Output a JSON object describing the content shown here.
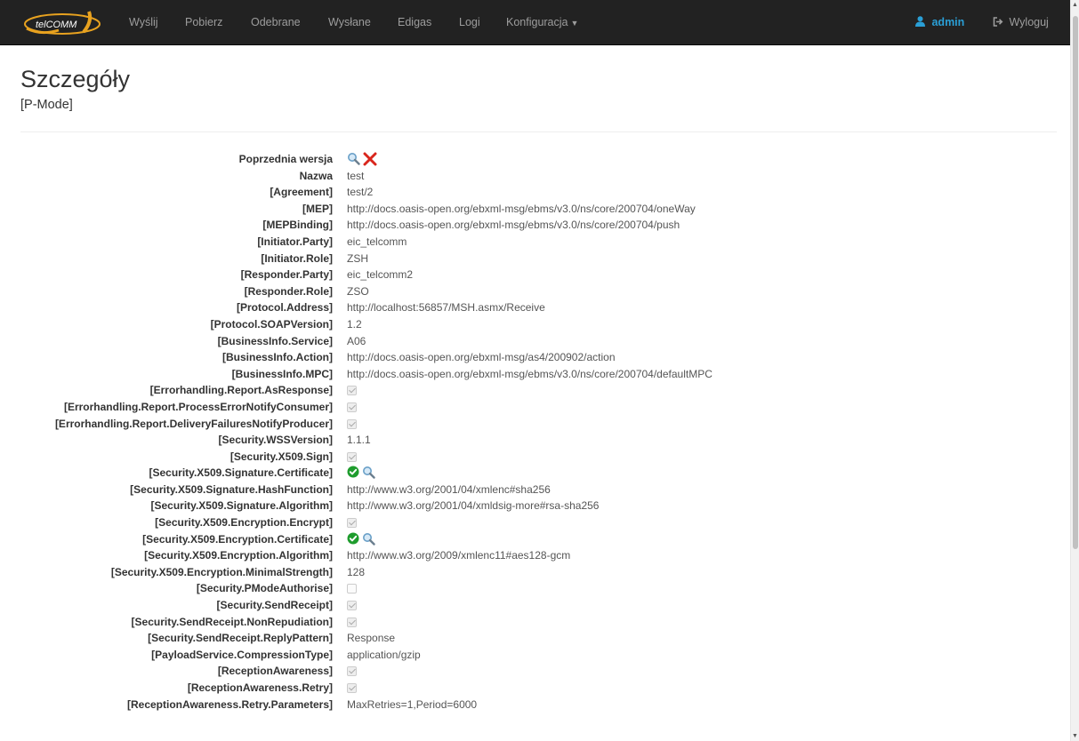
{
  "navbar": {
    "brand": "telCOMM",
    "items": [
      {
        "label": "Wyślij"
      },
      {
        "label": "Pobierz"
      },
      {
        "label": "Odebrane"
      },
      {
        "label": "Wysłane"
      },
      {
        "label": "Edigas"
      },
      {
        "label": "Logi"
      },
      {
        "label": "Konfiguracja"
      }
    ],
    "user": "admin",
    "logout": "Wyloguj"
  },
  "page": {
    "title": "Szczegóły",
    "subtitle": "[P-Mode]"
  },
  "details": [
    {
      "label": "Poprzednia wersja",
      "type": "icons",
      "icons": [
        "search-icon",
        "delete-icon"
      ]
    },
    {
      "label": "Nazwa",
      "type": "text",
      "value": "test"
    },
    {
      "label": "[Agreement]",
      "type": "text",
      "value": "test/2"
    },
    {
      "label": "[MEP]",
      "type": "text",
      "value": "http://docs.oasis-open.org/ebxml-msg/ebms/v3.0/ns/core/200704/oneWay"
    },
    {
      "label": "[MEPBinding]",
      "type": "text",
      "value": "http://docs.oasis-open.org/ebxml-msg/ebms/v3.0/ns/core/200704/push"
    },
    {
      "label": "[Initiator.Party]",
      "type": "text",
      "value": "eic_telcomm"
    },
    {
      "label": "[Initiator.Role]",
      "type": "text",
      "value": "ZSH"
    },
    {
      "label": "[Responder.Party]",
      "type": "text",
      "value": "eic_telcomm2"
    },
    {
      "label": "[Responder.Role]",
      "type": "text",
      "value": "ZSO"
    },
    {
      "label": "[Protocol.Address]",
      "type": "text",
      "value": "http://localhost:56857/MSH.asmx/Receive"
    },
    {
      "label": "[Protocol.SOAPVersion]",
      "type": "text",
      "value": "1.2"
    },
    {
      "label": "[BusinessInfo.Service]",
      "type": "text",
      "value": "A06"
    },
    {
      "label": "[BusinessInfo.Action]",
      "type": "text",
      "value": "http://docs.oasis-open.org/ebxml-msg/as4/200902/action"
    },
    {
      "label": "[BusinessInfo.MPC]",
      "type": "text",
      "value": "http://docs.oasis-open.org/ebxml-msg/ebms/v3.0/ns/core/200704/defaultMPC"
    },
    {
      "label": "[Errorhandling.Report.AsResponse]",
      "type": "checkbox",
      "checked": true
    },
    {
      "label": "[Errorhandling.Report.ProcessErrorNotifyConsumer]",
      "type": "checkbox",
      "checked": true
    },
    {
      "label": "[Errorhandling.Report.DeliveryFailuresNotifyProducer]",
      "type": "checkbox",
      "checked": true
    },
    {
      "label": "[Security.WSSVersion]",
      "type": "text",
      "value": "1.1.1"
    },
    {
      "label": "[Security.X509.Sign]",
      "type": "checkbox",
      "checked": true
    },
    {
      "label": "[Security.X509.Signature.Certificate]",
      "type": "icons",
      "icons": [
        "check-circle-icon",
        "search-icon"
      ]
    },
    {
      "label": "[Security.X509.Signature.HashFunction]",
      "type": "text",
      "value": "http://www.w3.org/2001/04/xmlenc#sha256"
    },
    {
      "label": "[Security.X509.Signature.Algorithm]",
      "type": "text",
      "value": "http://www.w3.org/2001/04/xmldsig-more#rsa-sha256"
    },
    {
      "label": "[Security.X509.Encryption.Encrypt]",
      "type": "checkbox",
      "checked": true
    },
    {
      "label": "[Security.X509.Encryption.Certificate]",
      "type": "icons",
      "icons": [
        "check-circle-icon",
        "search-icon"
      ]
    },
    {
      "label": "[Security.X509.Encryption.Algorithm]",
      "type": "text",
      "value": "http://www.w3.org/2009/xmlenc11#aes128-gcm"
    },
    {
      "label": "[Security.X509.Encryption.MinimalStrength]",
      "type": "text",
      "value": "128"
    },
    {
      "label": "[Security.PModeAuthorise]",
      "type": "checkbox",
      "checked": false
    },
    {
      "label": "[Security.SendReceipt]",
      "type": "checkbox",
      "checked": true
    },
    {
      "label": "[Security.SendReceipt.NonRepudiation]",
      "type": "checkbox",
      "checked": true
    },
    {
      "label": "[Security.SendReceipt.ReplyPattern]",
      "type": "text",
      "value": "Response"
    },
    {
      "label": "[PayloadService.CompressionType]",
      "type": "text",
      "value": "application/gzip"
    },
    {
      "label": "[ReceptionAwareness]",
      "type": "checkbox",
      "checked": true
    },
    {
      "label": "[ReceptionAwareness.Retry]",
      "type": "checkbox",
      "checked": true
    },
    {
      "label": "[ReceptionAwareness.Retry.Parameters]",
      "type": "text",
      "value": "MaxRetries=1,Period=6000"
    }
  ],
  "colors": {
    "navbar": "#222222",
    "nav_text": "#9d9d9d",
    "accent": "#2a9fd6",
    "success": "#1e9c2d",
    "danger": "#d9261c"
  }
}
